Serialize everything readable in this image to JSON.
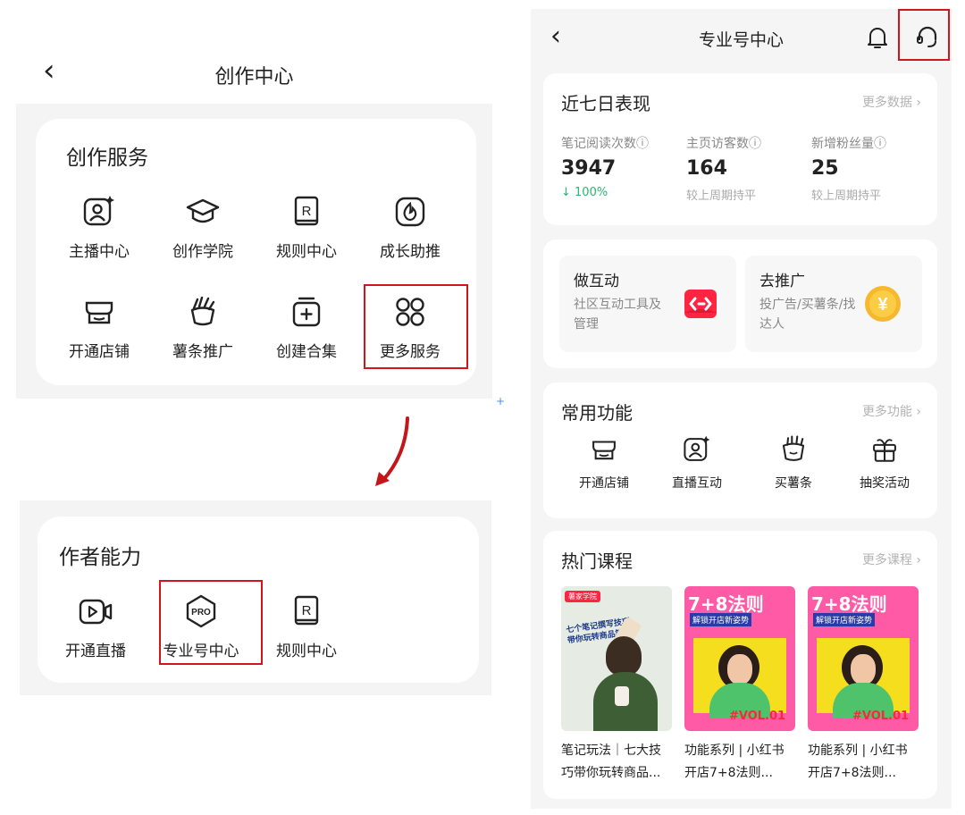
{
  "left": {
    "title": "创作中心",
    "services": {
      "title": "创作服务",
      "items": [
        {
          "label": "主播中心",
          "icon": "anchor-icon"
        },
        {
          "label": "创作学院",
          "icon": "graduation-cap-icon"
        },
        {
          "label": "规则中心",
          "icon": "rulebook-icon"
        },
        {
          "label": "成长助推",
          "icon": "flame-icon"
        },
        {
          "label": "开通店铺",
          "icon": "store-icon"
        },
        {
          "label": "薯条推广",
          "icon": "fries-icon"
        },
        {
          "label": "创建合集",
          "icon": "add-collection-icon"
        },
        {
          "label": "更多服务",
          "icon": "more-grid-icon"
        }
      ]
    },
    "abilities": {
      "title": "作者能力",
      "items": [
        {
          "label": "开通直播",
          "icon": "video-camera-icon"
        },
        {
          "label": "专业号中心",
          "icon": "pro-badge-icon",
          "badge": "PRO"
        },
        {
          "label": "规则中心",
          "icon": "rulebook-icon"
        }
      ]
    }
  },
  "right": {
    "title": "专业号中心",
    "performance": {
      "title": "近七日表现",
      "more": "更多数据",
      "stats": [
        {
          "label": "笔记阅读次数",
          "value": "3947",
          "sub": "↓ 100%"
        },
        {
          "label": "主页访客数",
          "value": "164",
          "sub": "较上周期持平"
        },
        {
          "label": "新增粉丝量",
          "value": "25",
          "sub": "较上周期持平"
        }
      ]
    },
    "promos": [
      {
        "title": "做互动",
        "desc": "社区互动工具及管理"
      },
      {
        "title": "去推广",
        "desc": "投广告/买薯条/找达人",
        "coin": "¥"
      }
    ],
    "functions": {
      "title": "常用功能",
      "more": "更多功能",
      "items": [
        {
          "label": "开通店铺",
          "icon": "store-icon"
        },
        {
          "label": "直播互动",
          "icon": "anchor-icon"
        },
        {
          "label": "买薯条",
          "icon": "fries-icon"
        },
        {
          "label": "抽奖活动",
          "icon": "gift-icon"
        }
      ]
    },
    "courses": {
      "title": "热门课程",
      "more": "更多课程",
      "items": [
        {
          "line1": "笔记玩法｜七大技",
          "line2": "巧带你玩转商品...",
          "thumb_text": "七个笔记撰写技巧 带你玩转商品笔记",
          "thumb_tag": "薯家学院"
        },
        {
          "line1": "功能系列 | 小红书",
          "line2": "开店7+8法则...",
          "thumb_text": "7+8法则",
          "thumb_sub": "解锁开店新姿势",
          "thumb_tag": "#VOL.01"
        },
        {
          "line1": "功能系列 | 小红书",
          "line2": "开店7+8法则...",
          "thumb_text": "7+8法则",
          "thumb_sub": "解锁开店新姿势",
          "thumb_tag": "#VOL.01"
        }
      ]
    }
  },
  "colors": {
    "highlight": "#d0161c",
    "accent_red": "#ff2442",
    "green": "#2bb673",
    "coin": "#f5b82e"
  }
}
